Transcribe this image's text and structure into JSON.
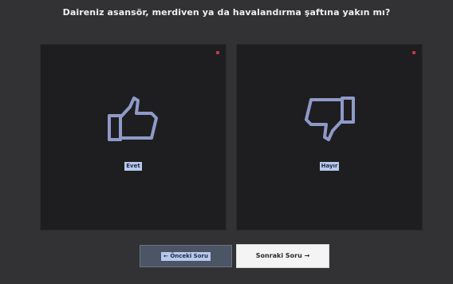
{
  "question": "Daireniz asansör, merdiven ya da havalandırma şaftına yakın mı?",
  "options": [
    {
      "label": "Evet",
      "icon": "thumbs-up-icon"
    },
    {
      "label": "Hayır",
      "icon": "thumbs-down-icon"
    }
  ],
  "navigation": {
    "prev_label": "← Önceki Soru",
    "next_label": "Sonraki Soru →"
  },
  "colors": {
    "background": "#323234",
    "card_background": "#1e1e20",
    "icon_stroke": "#8f9ac8",
    "accent": "#c0394a",
    "label_highlight": "#b7c9ec"
  }
}
